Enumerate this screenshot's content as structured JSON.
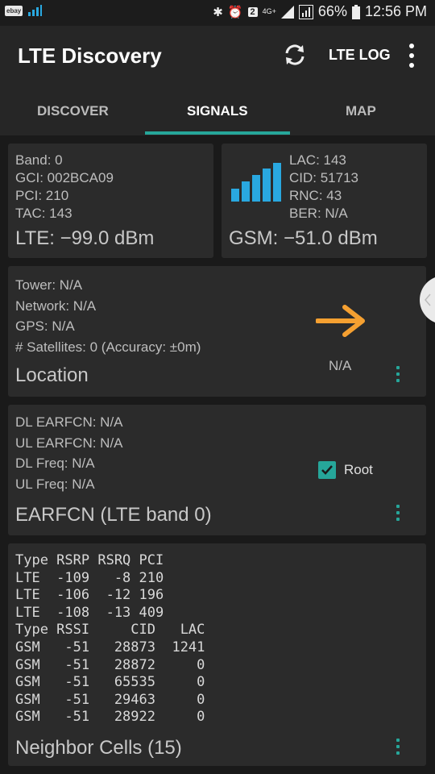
{
  "status": {
    "ebay": "ebay",
    "notif_count": "2",
    "network": "4G+",
    "battery": "66%",
    "time": "12:56 PM"
  },
  "appbar": {
    "title": "LTE Discovery",
    "log_label": "LTE LOG"
  },
  "tabs": [
    "DISCOVER",
    "SIGNALS",
    "MAP"
  ],
  "lte_card": {
    "band": "Band: 0",
    "gci": "GCI: 002BCA09",
    "pci": "PCI: 210",
    "tac": "TAC: 143",
    "signal": "LTE: −99.0 dBm"
  },
  "gsm_card": {
    "lac": "LAC: 143",
    "cid": "CID: 51713",
    "rnc": "RNC: 43",
    "ber": "BER: N/A",
    "signal": "GSM: −51.0 dBm",
    "bar_level": 5
  },
  "location_card": {
    "tower": "Tower: N/A",
    "network": "Network: N/A",
    "gps": "GPS: N/A",
    "satellites": "# Satellites: 0 (Accuracy: ±0m)",
    "title": "Location",
    "direction": "N/A"
  },
  "earfcn_card": {
    "dl_earfcn": "DL EARFCN: N/A",
    "ul_earfcn": "UL EARFCN: N/A",
    "dl_freq": "DL Freq: N/A",
    "ul_freq": "UL Freq: N/A",
    "root_label": "Root",
    "root_checked": true,
    "title": "EARFCN (LTE band 0)"
  },
  "neighbor_card": {
    "lines": [
      "Type RSRP RSRQ PCI",
      "LTE  -109   -8 210",
      "LTE  -106  -12 196",
      "LTE  -108  -13 409",
      "Type RSSI     CID   LAC",
      "GSM   -51   28873  1241",
      "GSM   -51   28872     0",
      "GSM   -51   65535     0",
      "GSM   -51   29463     0",
      "GSM   -51   28922     0"
    ],
    "title": "Neighbor Cells (15)"
  },
  "colors": {
    "accent": "#26a69a",
    "bars": "#29a8e0",
    "arrow": "#f5a031"
  }
}
